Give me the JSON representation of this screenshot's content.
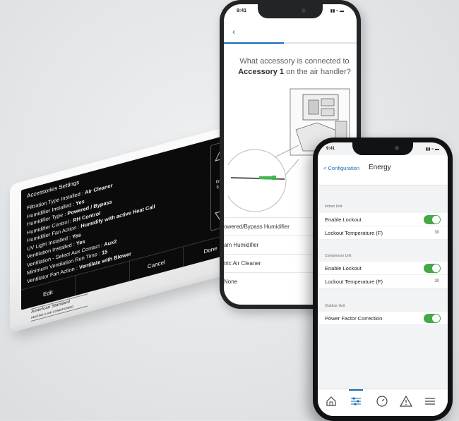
{
  "thermostat": {
    "screen_title": "Accessories Settings",
    "rows": [
      {
        "label": "Filtration Type Installed :",
        "value": "Air Cleaner"
      },
      {
        "label": "Humidifier Installed :",
        "value": "Yes"
      },
      {
        "label": "Humidifier Type :",
        "value": "Powered / Bypass"
      },
      {
        "label": "Humidifier Control :",
        "value": "RH Control"
      },
      {
        "label": "Humidifier Fan Action :",
        "value": "Humidify with active Heat Call"
      },
      {
        "label": "UV Light Installed :",
        "value": "Yes"
      },
      {
        "label": "Ventilation Installed :",
        "value": "Yes"
      },
      {
        "label": "Ventilation - Select Aux Contact :",
        "value": "Aux2"
      },
      {
        "label": "Minimum Ventilation Run Time :",
        "value": "15"
      },
      {
        "label": "Ventilator Fan Action :",
        "value": "Ventilate with Blower"
      }
    ],
    "group_line1": "Group",
    "group_line2": "5 of 8",
    "buttons": {
      "edit": "Edit",
      "blank": "",
      "cancel": "Cancel",
      "done": "Done"
    },
    "logo_text": "American Standard",
    "logo_sub": "HEATING & AIR CONDITIONING"
  },
  "back_phone": {
    "time": "9:41",
    "status_icons": "▮▮ ≈ ▬",
    "back_icon": "chevron-left-icon",
    "progress": 0.45,
    "question_pre": "What accessory is connected to",
    "question_bold": "Accessory 1",
    "question_post": "on the air handler?",
    "options": [
      "Powered/Bypass Humidifier",
      "Steam Humidifier",
      "Electric Air Cleaner",
      "None"
    ],
    "options_visible": [
      "owered/Bypass Humidifier",
      "am Humidifier",
      "tric Air Cleaner",
      "None"
    ]
  },
  "front_phone": {
    "time": "9:41",
    "status_icons": "▮▮ ≈ ▬",
    "back_label": "< Configuration",
    "title": "Energy",
    "sections": [
      {
        "label": "Indoor Unit",
        "rows": [
          {
            "label": "Enable Lockout",
            "type": "toggle",
            "on": true
          },
          {
            "label": "Lockout Temperature (F)",
            "type": "value",
            "value": "30"
          }
        ]
      },
      {
        "label": "Compressor Unit",
        "rows": [
          {
            "label": "Enable Lockout",
            "type": "toggle",
            "on": true
          },
          {
            "label": "Lockout Temperature (F)",
            "type": "value",
            "value": "30"
          }
        ]
      },
      {
        "label": "Outdoor Unit",
        "rows": [
          {
            "label": "Power Factor Correction",
            "type": "toggle",
            "on": true
          }
        ]
      }
    ],
    "tabs": [
      "home-icon",
      "sliders-icon",
      "gauge-icon",
      "alert-icon",
      "menu-icon"
    ],
    "active_tab": 1,
    "colors": {
      "accent": "#1a6ab5",
      "toggle_on": "#47a84a"
    }
  }
}
